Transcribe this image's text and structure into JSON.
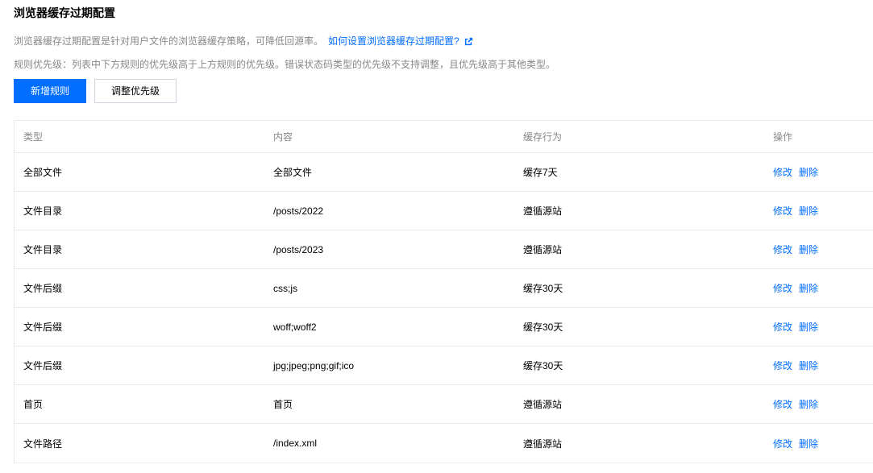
{
  "header": {
    "title": "浏览器缓存过期配置",
    "description": "浏览器缓存过期配置是针对用户文件的浏览器缓存策略，可降低回源率。",
    "help_link": "如何设置浏览器缓存过期配置?",
    "priority_note": "规则优先级：列表中下方规则的优先级高于上方规则的优先级。错误状态码类型的优先级不支持调整，且优先级高于其他类型。"
  },
  "toolbar": {
    "add_rule_label": "新增规则",
    "adjust_priority_label": "调整优先级"
  },
  "table": {
    "columns": [
      "类型",
      "内容",
      "缓存行为",
      "操作"
    ],
    "rows": [
      {
        "type": "全部文件",
        "content": "全部文件",
        "behavior": "缓存7天",
        "edit": "修改",
        "delete": "删除"
      },
      {
        "type": "文件目录",
        "content": "/posts/2022",
        "behavior": "遵循源站",
        "edit": "修改",
        "delete": "删除"
      },
      {
        "type": "文件目录",
        "content": "/posts/2023",
        "behavior": "遵循源站",
        "edit": "修改",
        "delete": "删除"
      },
      {
        "type": "文件后缀",
        "content": "css;js",
        "behavior": "缓存30天",
        "edit": "修改",
        "delete": "删除"
      },
      {
        "type": "文件后缀",
        "content": "woff;woff2",
        "behavior": "缓存30天",
        "edit": "修改",
        "delete": "删除"
      },
      {
        "type": "文件后缀",
        "content": "jpg;jpeg;png;gif;ico",
        "behavior": "缓存30天",
        "edit": "修改",
        "delete": "删除"
      },
      {
        "type": "首页",
        "content": "首页",
        "behavior": "遵循源站",
        "edit": "修改",
        "delete": "删除"
      },
      {
        "type": "文件路径",
        "content": "/index.xml",
        "behavior": "遵循源站",
        "edit": "修改",
        "delete": "删除"
      }
    ]
  },
  "colors": {
    "primary": "#006eff",
    "muted_text": "#888888",
    "border": "#e7eaef"
  },
  "icons": {
    "help_link_icon": "external-link-icon"
  }
}
